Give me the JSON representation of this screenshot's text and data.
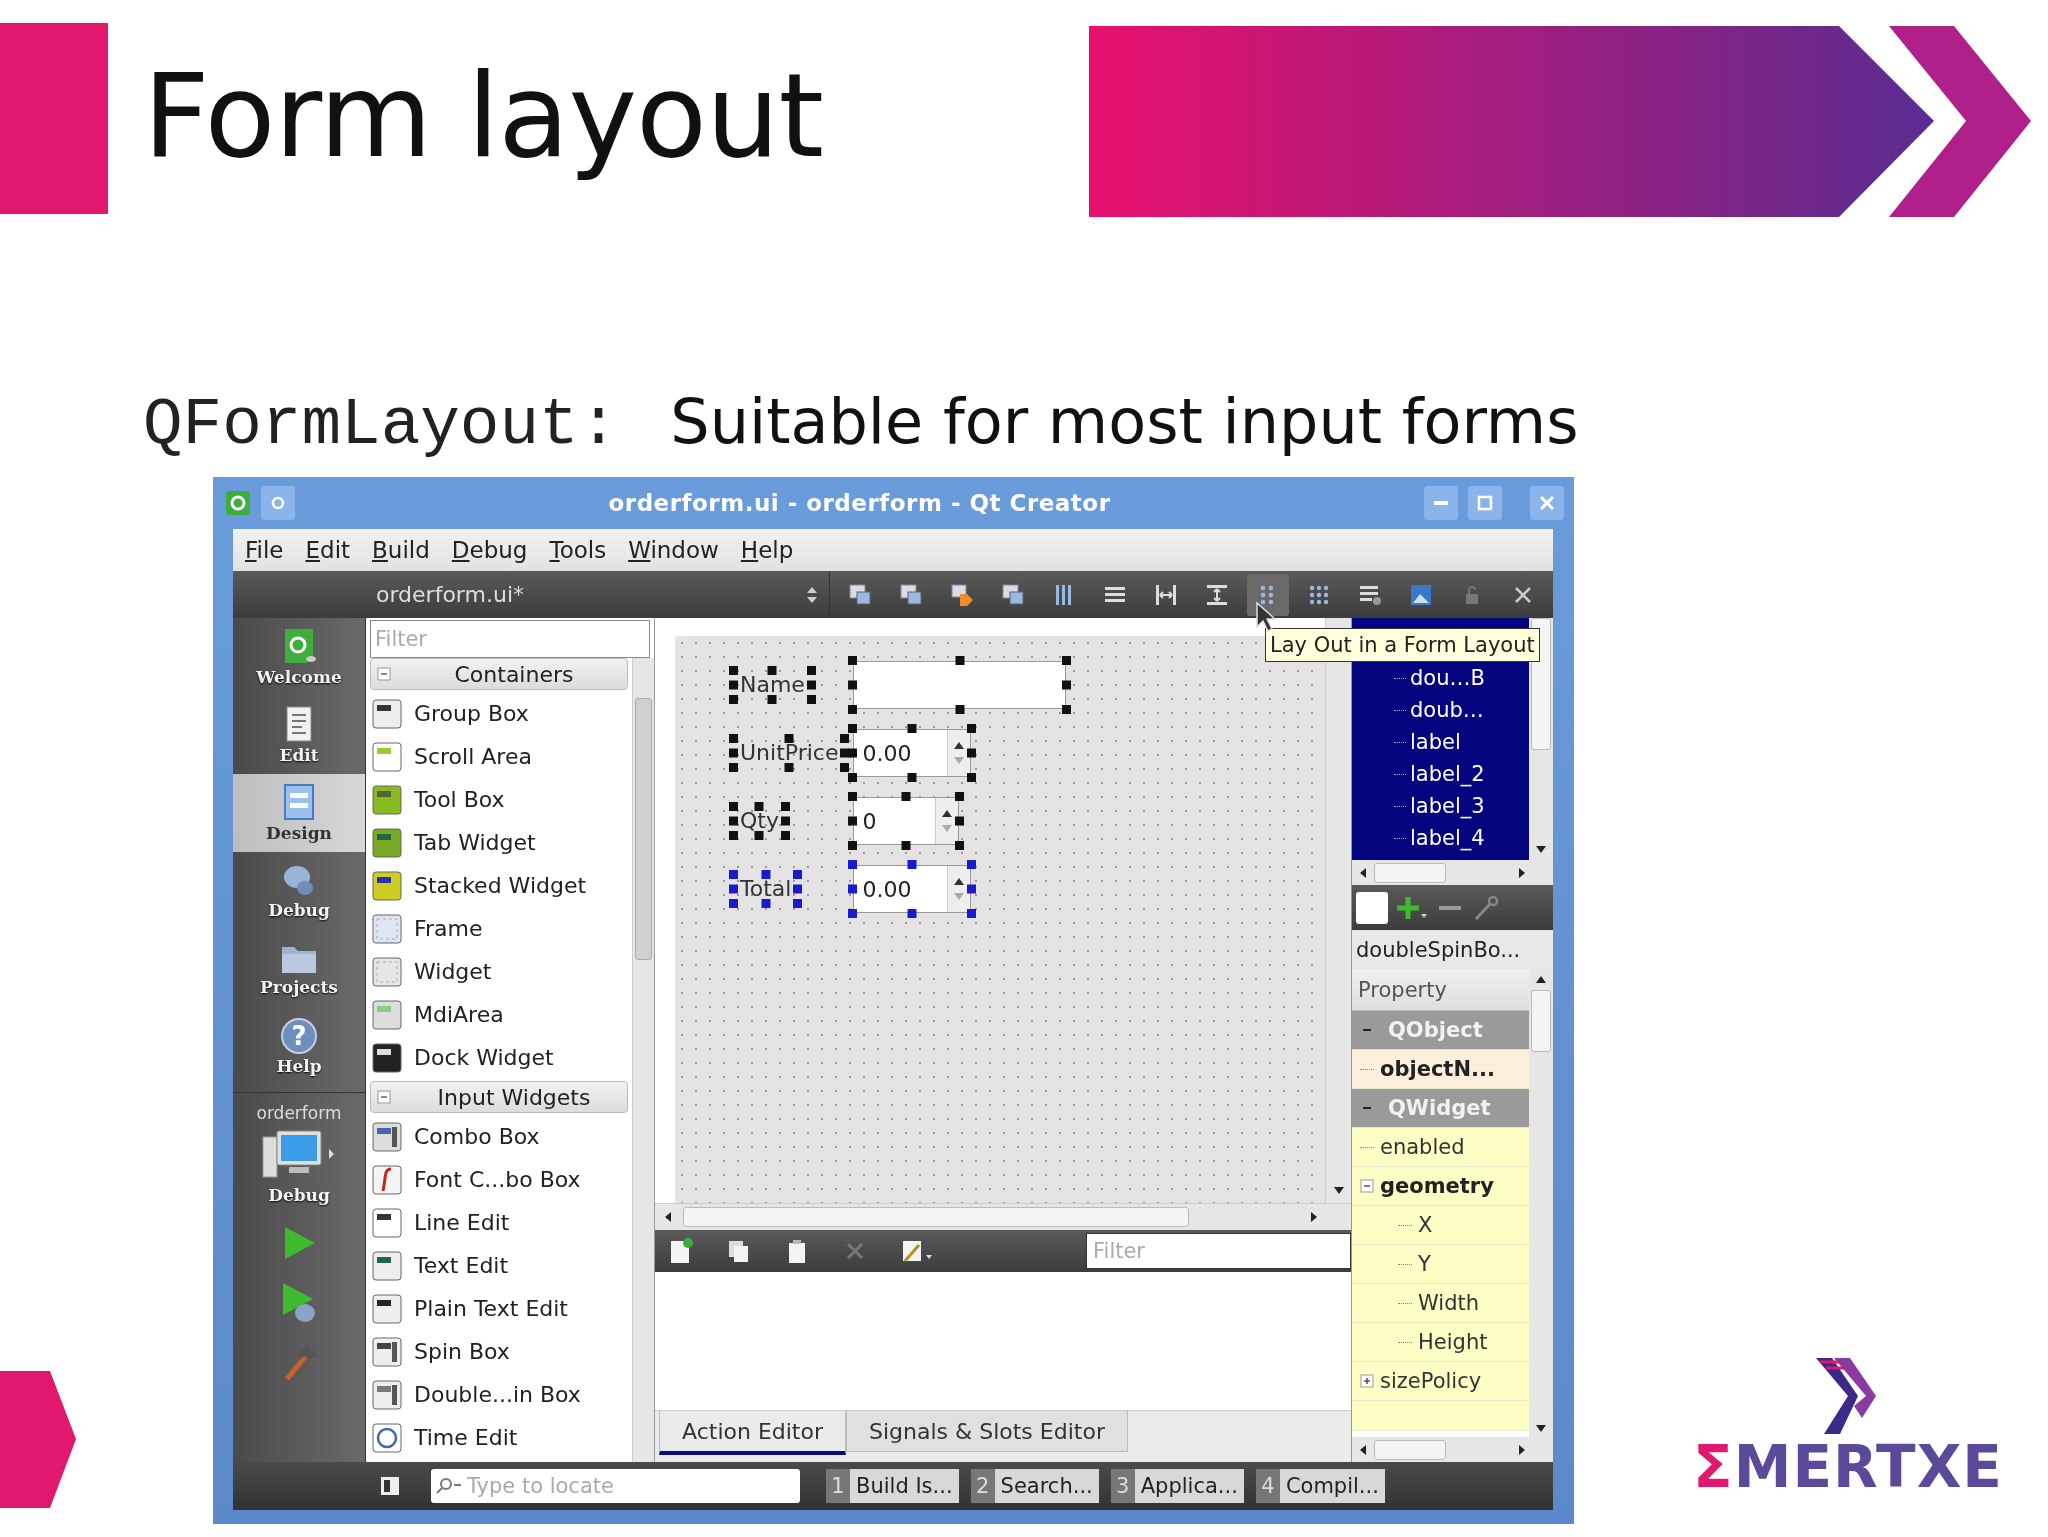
{
  "slide": {
    "title": "Form layout",
    "code": "QFormLayout:",
    "subtitle": "Suitable for most input forms",
    "logo": "ΣMERTXE"
  },
  "window": {
    "title": "orderform.ui - orderform - Qt Creator"
  },
  "menu": [
    "File",
    "Edit",
    "Build",
    "Debug",
    "Tools",
    "Window",
    "Help"
  ],
  "editor": {
    "file": "orderform.ui*"
  },
  "tooltip": "Lay Out in a Form Layout",
  "modes": [
    {
      "label": "Welcome",
      "kind": "qt",
      "selected": false
    },
    {
      "label": "Edit",
      "kind": "document",
      "selected": false
    },
    {
      "label": "Design",
      "kind": "form",
      "selected": true
    },
    {
      "label": "Debug",
      "kind": "bug",
      "selected": false
    },
    {
      "label": "Projects",
      "kind": "folder",
      "selected": false
    },
    {
      "label": "Help",
      "kind": "help",
      "selected": false,
      "glyph": "?"
    }
  ],
  "target": {
    "project": "orderform",
    "config": "Debug"
  },
  "widget_box": {
    "placeholder": "Filter",
    "groups": [
      {
        "label": "Containers",
        "expanded": true,
        "items": [
          {
            "label": "Group Box",
            "kind": "groupbox"
          },
          {
            "label": "Scroll Area",
            "kind": "scrollarea"
          },
          {
            "label": "Tool Box",
            "kind": "toolbox"
          },
          {
            "label": "Tab Widget",
            "kind": "tabwidget"
          },
          {
            "label": "Stacked Widget",
            "kind": "stacked"
          },
          {
            "label": "Frame",
            "kind": "frame"
          },
          {
            "label": "Widget",
            "kind": "widget"
          },
          {
            "label": "MdiArea",
            "kind": "mdi"
          },
          {
            "label": "Dock Widget",
            "kind": "dock"
          }
        ]
      },
      {
        "label": "Input Widgets",
        "expanded": true,
        "items": [
          {
            "label": "Combo Box",
            "kind": "combo"
          },
          {
            "label": "Font C...bo Box",
            "kind": "fontcombo"
          },
          {
            "label": "Line Edit",
            "kind": "lineedit"
          },
          {
            "label": "Text Edit",
            "kind": "textedit"
          },
          {
            "label": "Plain Text Edit",
            "kind": "plaintext"
          },
          {
            "label": "Spin Box",
            "kind": "spin"
          },
          {
            "label": "Double...in Box",
            "kind": "doublespin"
          },
          {
            "label": "Time Edit",
            "kind": "time"
          }
        ]
      }
    ]
  },
  "form": {
    "fields": [
      {
        "label": "Name",
        "kind": "line",
        "selected": true,
        "current": false
      },
      {
        "label": "UnitPrice",
        "kind": "double",
        "value": "0.00",
        "selected": true,
        "current": false
      },
      {
        "label": "Qty",
        "kind": "spin",
        "value": "0",
        "selected": true,
        "current": false
      },
      {
        "label": "Total",
        "kind": "double",
        "value": "0.00",
        "selected": true,
        "current": true
      }
    ]
  },
  "object_tree": [
    "dou…B",
    "doub…",
    "label",
    "label_2",
    "label_3",
    "label_4"
  ],
  "property_editor": {
    "object": "doubleSpinBo...",
    "header": "Property",
    "rows": [
      {
        "label": "QObject",
        "kind": "class",
        "expanded": true
      },
      {
        "label": "objectN...",
        "kind": "changed"
      },
      {
        "label": "QWidget",
        "kind": "class",
        "expanded": true
      },
      {
        "label": "enabled",
        "kind": "property"
      },
      {
        "label": "geometry",
        "kind": "changed",
        "expanded": true,
        "children": [
          {
            "label": "X"
          },
          {
            "label": "Y"
          },
          {
            "label": "Width"
          },
          {
            "label": "Height"
          }
        ]
      },
      {
        "label": "sizePolicy",
        "kind": "property",
        "expanded": false
      }
    ]
  },
  "action_editor": {
    "placeholder": "Filter",
    "tabs": [
      {
        "label": "Action Editor",
        "selected": true
      },
      {
        "label": "Signals & Slots Editor",
        "selected": false
      }
    ]
  },
  "locator": {
    "placeholder": "Type to locate"
  },
  "output_panes": [
    {
      "number": "1",
      "label": "Build Is..."
    },
    {
      "number": "2",
      "label": "Search..."
    },
    {
      "number": "3",
      "label": "Applica..."
    },
    {
      "number": "4",
      "label": "Compil..."
    }
  ]
}
